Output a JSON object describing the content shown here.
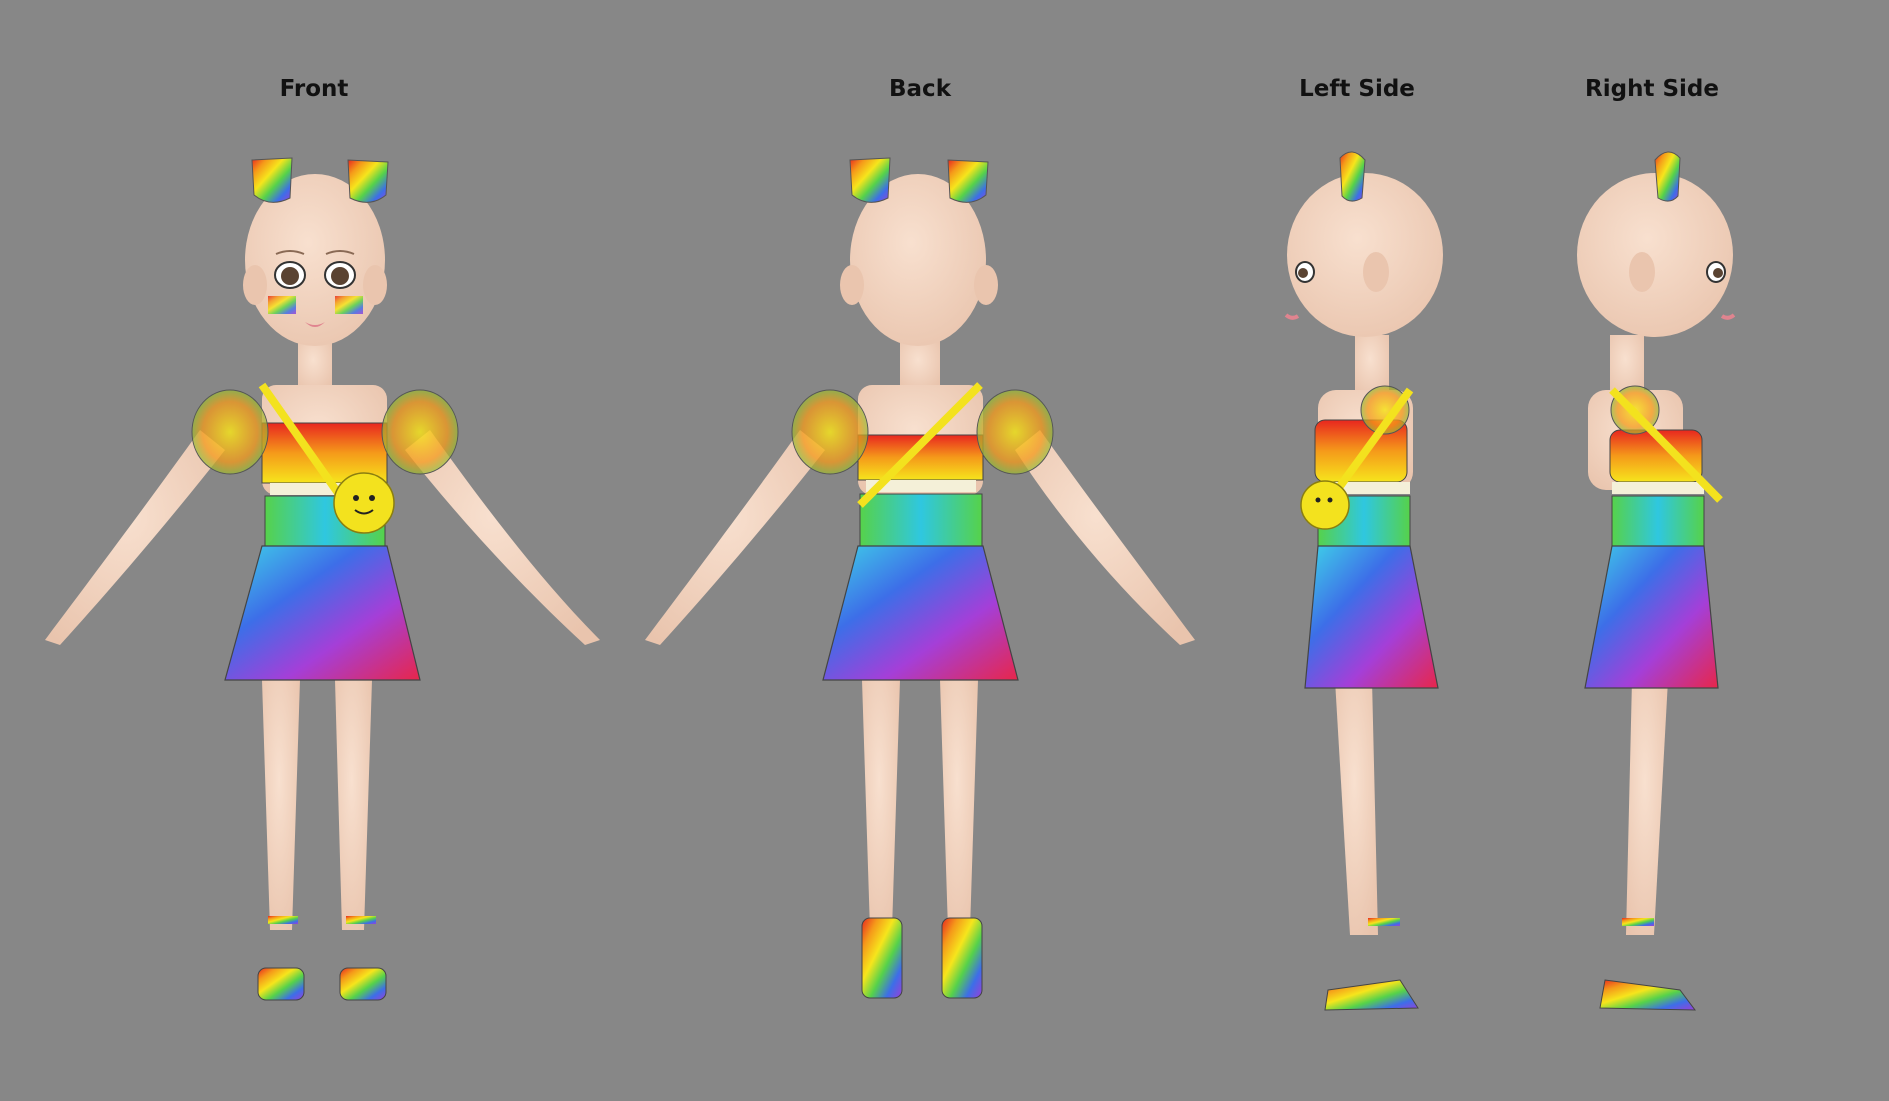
{
  "sheet": {
    "background": "#878787",
    "views": [
      {
        "label": "Front"
      },
      {
        "label": "Back"
      },
      {
        "label": "Left Side"
      },
      {
        "label": "Right Side"
      }
    ]
  },
  "colors": {
    "skin": "#f4d6c3",
    "skin_shade": "#e3b9a2",
    "bag": "#f3e21e",
    "rainbow": [
      "#e8261f",
      "#f59a1a",
      "#f6e51c",
      "#56d24a",
      "#2fc7e0",
      "#3d6ee8",
      "#9a3fd8",
      "#e02f86"
    ]
  },
  "icons": [
    "hair-bow-icon",
    "crossbody-bag-icon",
    "sandal-icon"
  ]
}
